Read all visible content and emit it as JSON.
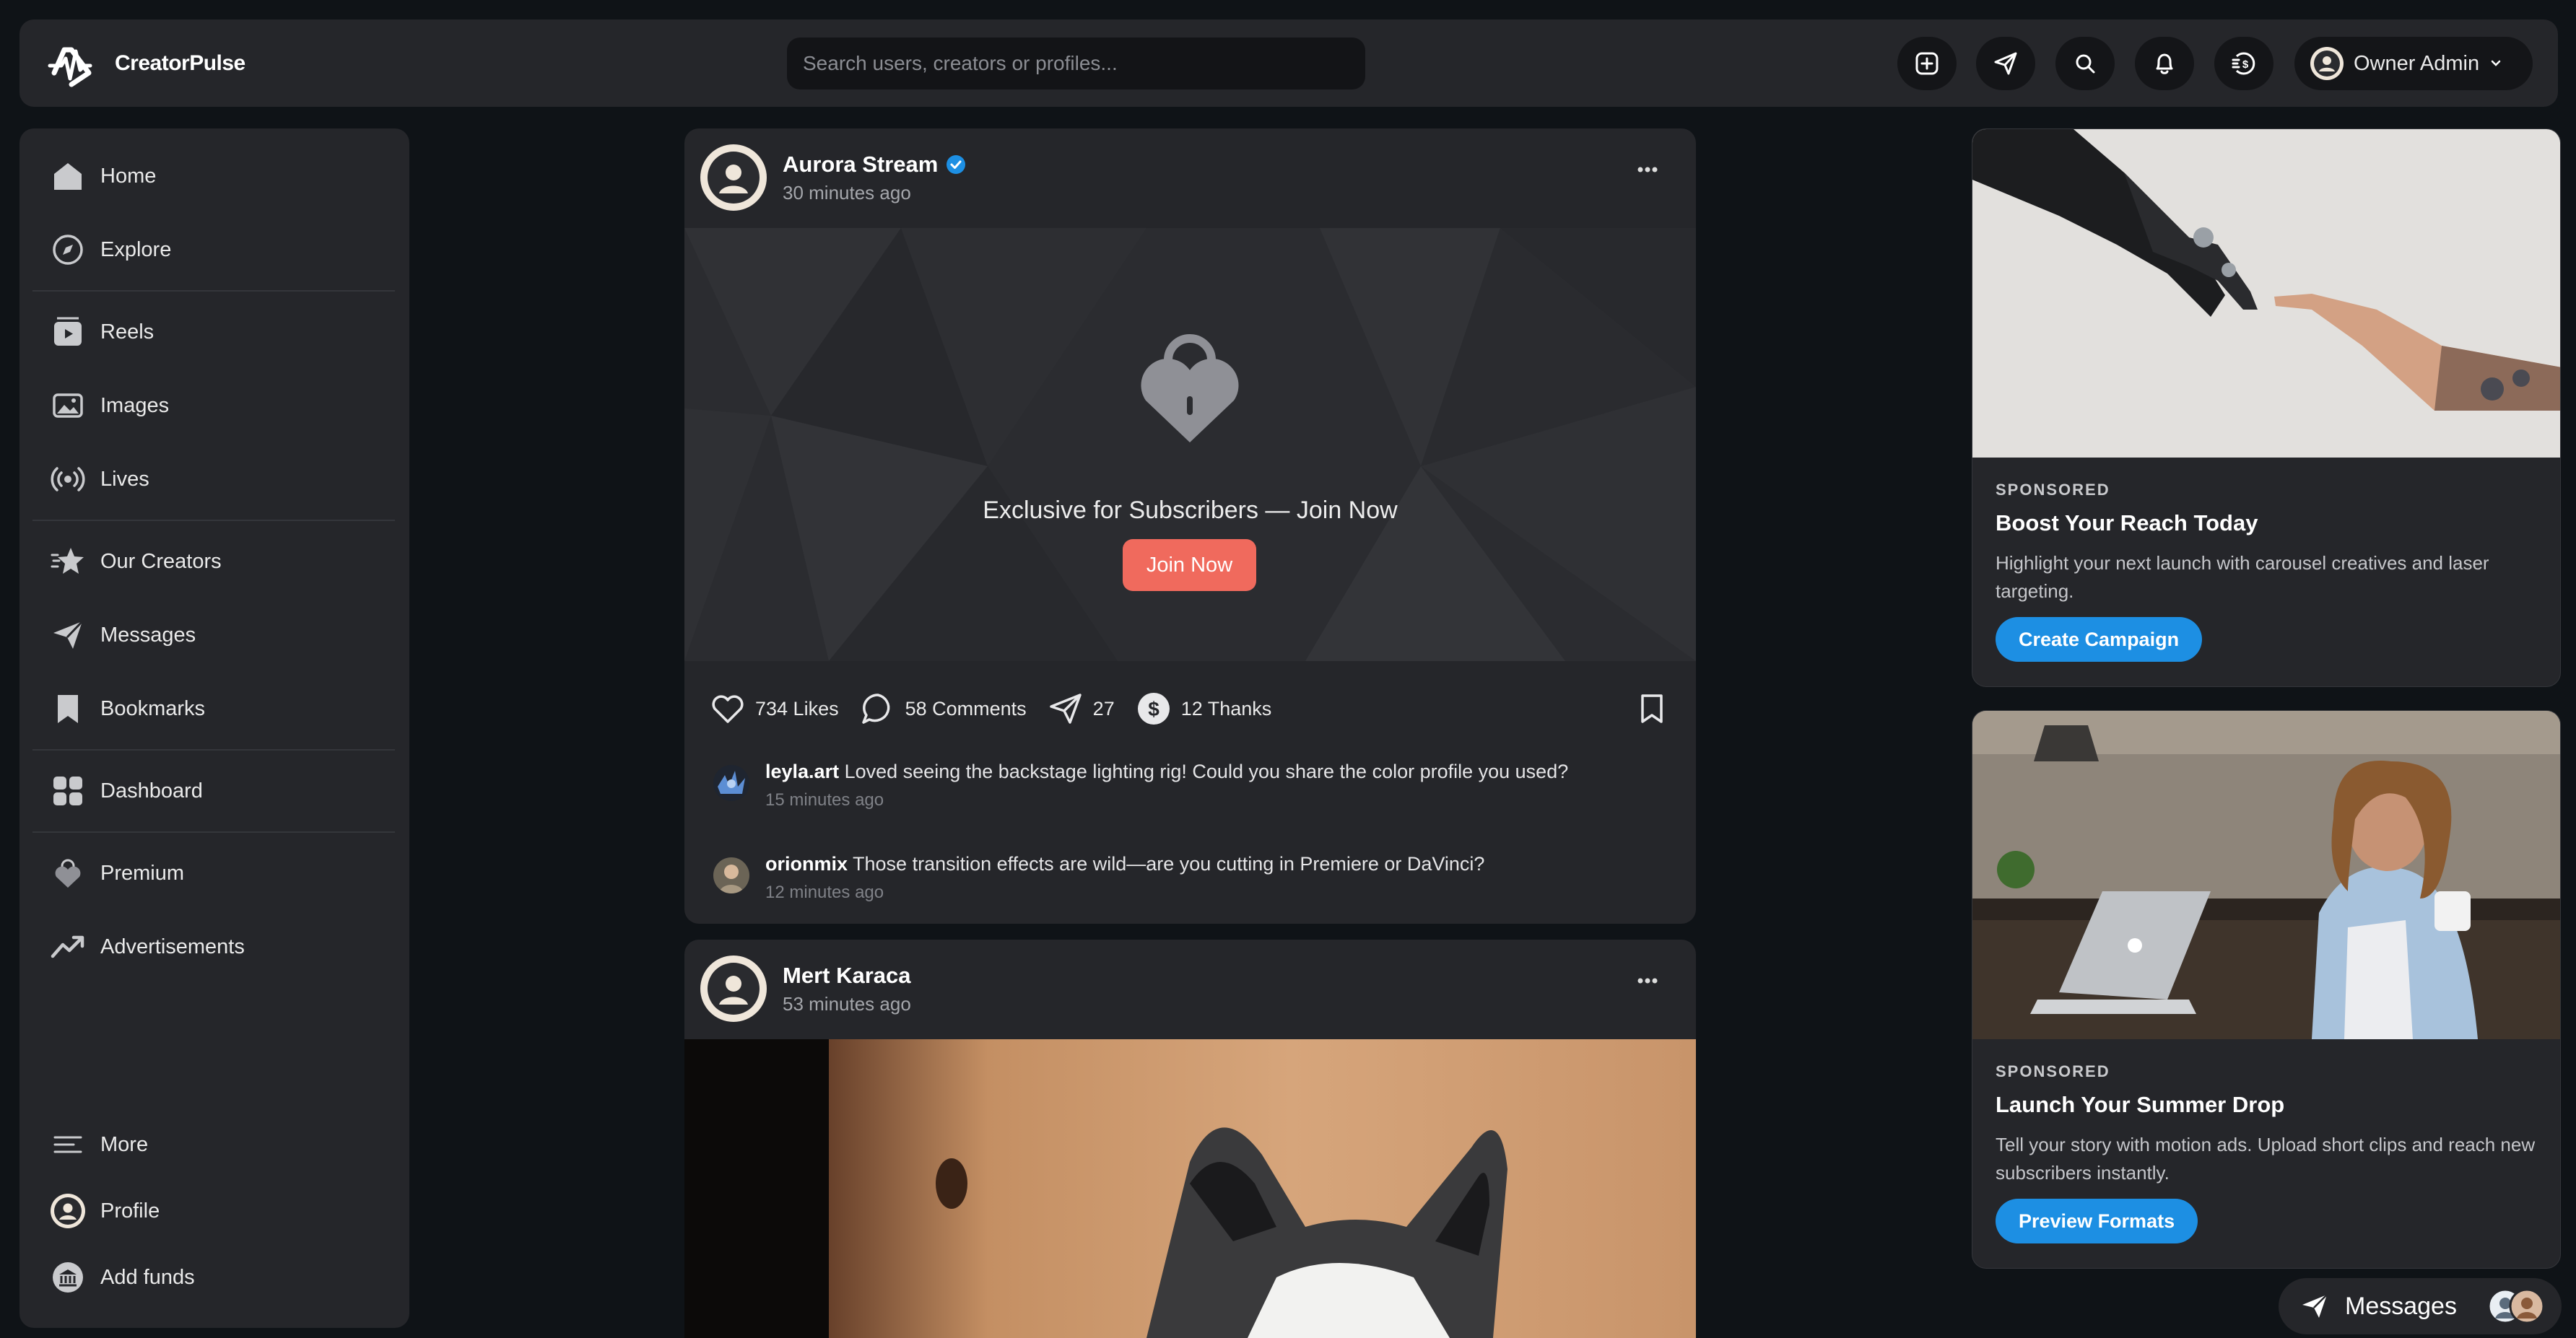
{
  "brand": {
    "name": "CreatorPulse"
  },
  "search": {
    "placeholder": "Search users, creators or profiles..."
  },
  "topbar": {
    "icons": [
      "add-post-icon",
      "send-icon",
      "search-icon",
      "bell-icon",
      "coin-icon"
    ],
    "user": {
      "name": "Owner Admin"
    }
  },
  "sidebar": {
    "items": [
      {
        "label": "Home",
        "icon": "home-icon"
      },
      {
        "label": "Explore",
        "icon": "compass-icon"
      },
      {
        "label": "Reels",
        "icon": "reels-icon"
      },
      {
        "label": "Images",
        "icon": "images-icon"
      },
      {
        "label": "Lives",
        "icon": "broadcast-icon"
      },
      {
        "label": "Our Creators",
        "icon": "star-icon"
      },
      {
        "label": "Messages",
        "icon": "paper-plane-icon"
      },
      {
        "label": "Bookmarks",
        "icon": "bookmark-icon"
      },
      {
        "label": "Dashboard",
        "icon": "dashboard-icon"
      },
      {
        "label": "Premium",
        "icon": "lock-heart-icon"
      },
      {
        "label": "Advertisements",
        "icon": "trend-icon"
      }
    ],
    "bottom": [
      {
        "label": "More",
        "icon": "menu-icon"
      },
      {
        "label": "Profile",
        "icon": "avatar-icon"
      },
      {
        "label": "Add funds",
        "icon": "bank-icon"
      }
    ]
  },
  "posts": [
    {
      "author": "Aurora Stream",
      "time": "30 minutes ago",
      "locked_text": "Exclusive for Subscribers — Join Now",
      "join_label": "Join Now",
      "likes": "734 Likes",
      "comments_count": "58 Comments",
      "shares": "27",
      "thanks": "12 Thanks",
      "comments": [
        {
          "user": "leyla.art",
          "text": "Loved seeing the backstage lighting rig! Could you share the color profile you used?",
          "time": "15 minutes ago"
        },
        {
          "user": "orionmix",
          "text": "Those transition effects are wild—are you cutting in Premiere or DaVinci?",
          "time": "12 minutes ago"
        }
      ]
    },
    {
      "author": "Mert Karaca",
      "time": "53 minutes ago"
    }
  ],
  "ads": [
    {
      "kicker": "SPONSORED",
      "title": "Boost Your Reach Today",
      "desc": "Highlight your next launch with carousel creatives and laser targeting.",
      "cta": "Create Campaign"
    },
    {
      "kicker": "SPONSORED",
      "title": "Launch Your Summer Drop",
      "desc": "Tell your story with motion ads. Upload short clips and reach new subscribers instantly.",
      "cta": "Preview Formats"
    }
  ],
  "messages_widget": {
    "label": "Messages"
  },
  "colors": {
    "accent": "#1d8fe3",
    "join": "#f06a5d",
    "panel": "#25262a",
    "bg": "#0f1317"
  }
}
